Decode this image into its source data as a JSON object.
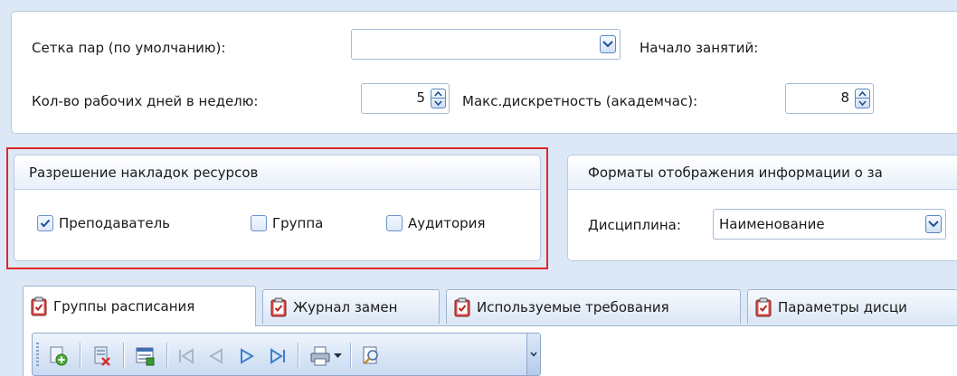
{
  "settings": {
    "grid_label": "Сетка пар (по умолчанию):",
    "grid_value": "",
    "start_label": "Начало занятий:",
    "workdays_label": "Кол-во рабочих дней в неделю:",
    "workdays_value": "5",
    "discreteness_label": "Макс.дискретность (академчас):",
    "discreteness_value": "8"
  },
  "overlaps": {
    "title": "Разрешение накладок ресурсов",
    "items": [
      {
        "label": "Преподаватель",
        "checked": true
      },
      {
        "label": "Группа",
        "checked": false
      },
      {
        "label": "Аудитория",
        "checked": false
      }
    ]
  },
  "formats": {
    "title": "Форматы отображения информации о за",
    "discipline_label": "Дисциплина:",
    "discipline_value": "Наименование"
  },
  "tabs": [
    {
      "label": "Группы расписания",
      "active": true
    },
    {
      "label": "Журнал замен",
      "active": false
    },
    {
      "label": "Используемые требования",
      "active": false
    },
    {
      "label": "Параметры дисци",
      "active": false
    }
  ],
  "toolbar": {
    "buttons": [
      "add-icon",
      "delete-icon",
      "edit-icon",
      "first-icon",
      "prev-icon",
      "next-icon",
      "last-icon",
      "print-icon",
      "dropdown-icon",
      "find-icon"
    ]
  },
  "colors": {
    "background": "#dde8f6",
    "panel_border": "#b9c9de",
    "highlight": "#e0262b",
    "accent": "#3f7fcc"
  }
}
